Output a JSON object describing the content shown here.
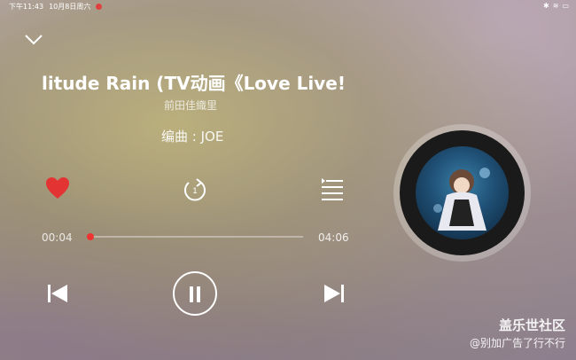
{
  "status_bar": {
    "time": "下午11:43",
    "date": "10月8日周六",
    "right_icons": [
      "bluetooth-icon",
      "wifi-icon",
      "battery-icon"
    ]
  },
  "song": {
    "title": "litude Rain (TV动画《Love Live! 虹咲",
    "artist": "前田佳織里",
    "lyric_line": "编曲 : JOE"
  },
  "progress": {
    "current": "00:04",
    "total": "04:06",
    "fraction": 0.016
  },
  "colors": {
    "accent": "#e33333"
  },
  "watermark": {
    "brand": "盖乐世社区",
    "note": "@别加广告了行不行"
  }
}
